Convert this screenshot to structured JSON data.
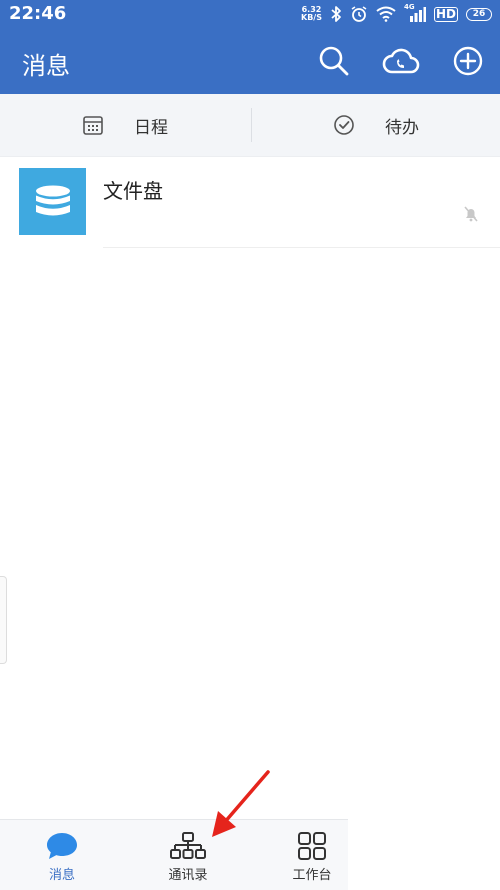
{
  "status_bar": {
    "time": "22:46",
    "net_speed_value": "6.32",
    "net_speed_unit": "KB/S",
    "network_type": "4G",
    "hd_label": "HD",
    "battery": "26"
  },
  "header": {
    "title": "消息",
    "search_icon": "search-icon",
    "cloud_phone_icon": "cloud-phone-icon",
    "add_icon": "plus-circle-icon"
  },
  "quick_actions": [
    {
      "label": "日程",
      "icon": "calendar-icon"
    },
    {
      "label": "待办",
      "icon": "check-circle-icon"
    }
  ],
  "conversations": [
    {
      "title": "文件盘",
      "avatar_icon": "database-icon",
      "muted": true
    }
  ],
  "bottom_nav": [
    {
      "label": "消息",
      "icon": "chat-bubble-icon",
      "active": true
    },
    {
      "label": "通讯录",
      "icon": "org-chart-icon",
      "active": false
    },
    {
      "label": "工作台",
      "icon": "grid-icon",
      "active": false
    }
  ],
  "colors": {
    "brand": "#3a6fc4",
    "avatar": "#3fa9e0",
    "annotation_arrow": "#e5241c"
  }
}
